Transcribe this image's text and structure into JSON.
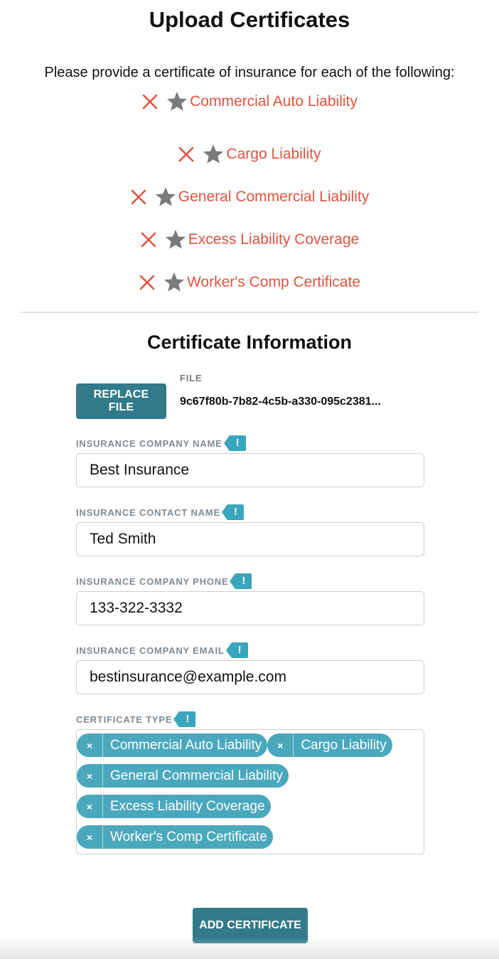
{
  "header": {
    "title": "Upload Certificates",
    "intro": "Please provide a certificate of insurance for each of the following:"
  },
  "requirements": [
    {
      "label": "Commercial Auto Liability",
      "status": "missing",
      "status_icon": "x-icon",
      "required_icon": "star-icon"
    },
    {
      "label": "Cargo Liability",
      "status": "missing",
      "status_icon": "x-icon",
      "required_icon": "star-icon"
    },
    {
      "label": "General Commercial Liability",
      "status": "missing",
      "status_icon": "x-icon",
      "required_icon": "star-icon"
    },
    {
      "label": "Excess Liability Coverage",
      "status": "missing",
      "status_icon": "x-icon",
      "required_icon": "star-icon"
    },
    {
      "label": "Worker's Comp Certificate",
      "status": "missing",
      "status_icon": "x-icon",
      "required_icon": "star-icon"
    }
  ],
  "section": {
    "title": "Certificate Information"
  },
  "file": {
    "button_label": "REPLACE FILE",
    "label": "FILE",
    "name": "9c67f80b-7b82-4c5b-a330-095c2381..."
  },
  "fields": {
    "company_name": {
      "label": "INSURANCE COMPANY NAME",
      "value": "Best Insurance",
      "flag": "!"
    },
    "contact_name": {
      "label": "INSURANCE CONTACT NAME",
      "value": "Ted Smith",
      "flag": "!"
    },
    "company_phone": {
      "label": "INSURANCE COMPANY PHONE",
      "value": "133-322-3332",
      "flag": "!"
    },
    "company_email": {
      "label": "INSURANCE COMPANY EMAIL",
      "value": "bestinsurance@example.com",
      "flag": "!"
    },
    "certificate_type": {
      "label": "CERTIFICATE TYPE",
      "flag": "!",
      "remove_glyph": "×",
      "tags": [
        "Commercial Auto Liability",
        "Cargo Liability",
        "General Commercial Liability",
        "Excess Liability Coverage",
        "Worker's Comp Certificate"
      ]
    }
  },
  "actions": {
    "add_label": "ADD CERTIFICATE"
  },
  "colors": {
    "accent": "#327a8a",
    "tag": "#4aa8bd",
    "flag": "#3aa6bd",
    "missing": "#e0533f",
    "star": "#7a7a7a"
  }
}
